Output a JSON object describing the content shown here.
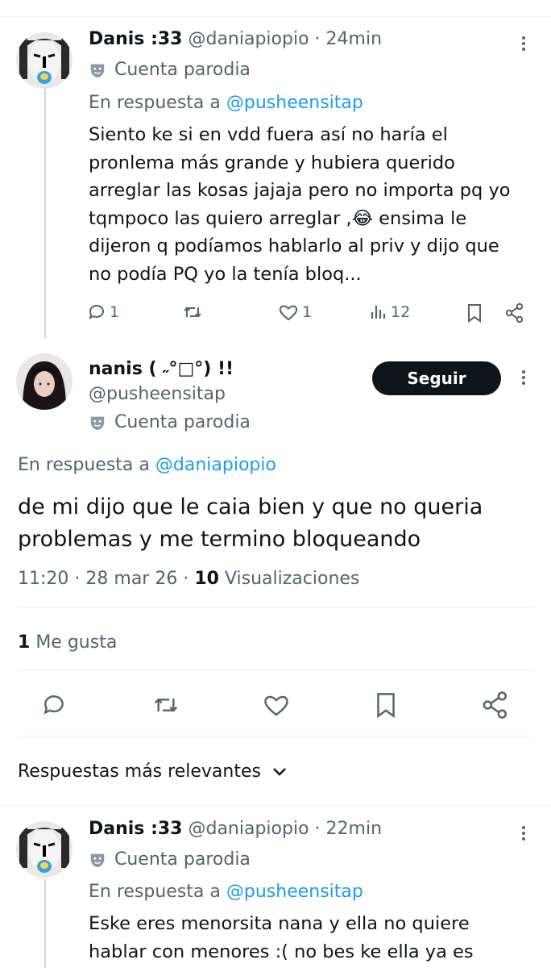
{
  "reply1": {
    "display_name": "Danis :33",
    "handle": "@daniapiopio",
    "separator": "·",
    "time": "24min",
    "parody_label": "Cuenta parodia",
    "reply_prefix": "En respuesta a",
    "reply_handle": "@pusheensitap",
    "text_lines": [
      "Siento ke si en vdd fuera así no haría el",
      "pronlema más grande y hubiera querido",
      "arreglar las kosas jajaja pero no importa pq yo",
      "tqmpoco las quiero arreglar ,😂 ensima le",
      "dijeron q podíamos hablarlo al priv y dijo que",
      "no podía PQ yo la tenía bloq..."
    ],
    "reply_count": "1",
    "like_count": "1",
    "view_count": "12"
  },
  "main_post": {
    "display_name": "nanis ( ˶°□°) !!",
    "handle": "@pusheensitap",
    "follow_label": "Seguir",
    "parody_label": "Cuenta parodia",
    "reply_prefix": "En respuesta a",
    "reply_handle": "@daniapiopio",
    "text_lines": [
      "de mi dijo que le caia bien y que no queria",
      "problemas y me termino bloqueando"
    ],
    "time": "11:20",
    "sep1": "·",
    "date": "28 mar 26",
    "sep2": "·",
    "views_count": "10",
    "views_label": "Visualizaciones",
    "likes_count": "1",
    "likes_label": "Me gusta"
  },
  "sort": {
    "label": "Respuestas más relevantes"
  },
  "reply2": {
    "display_name": "Danis :33",
    "handle": "@daniapiopio",
    "separator": "·",
    "time": "22min",
    "parody_label": "Cuenta parodia",
    "reply_prefix": "En respuesta a",
    "reply_handle": "@pusheensitap",
    "text_lines": [
      "Eske eres menorsita nana y ella no quiere",
      "hablar con menores :( no bes ke ella ya es"
    ]
  },
  "colors": {
    "link": "#1d9bf0",
    "muted": "#536471",
    "text": "#0f1419",
    "divider": "#eff3f4"
  }
}
